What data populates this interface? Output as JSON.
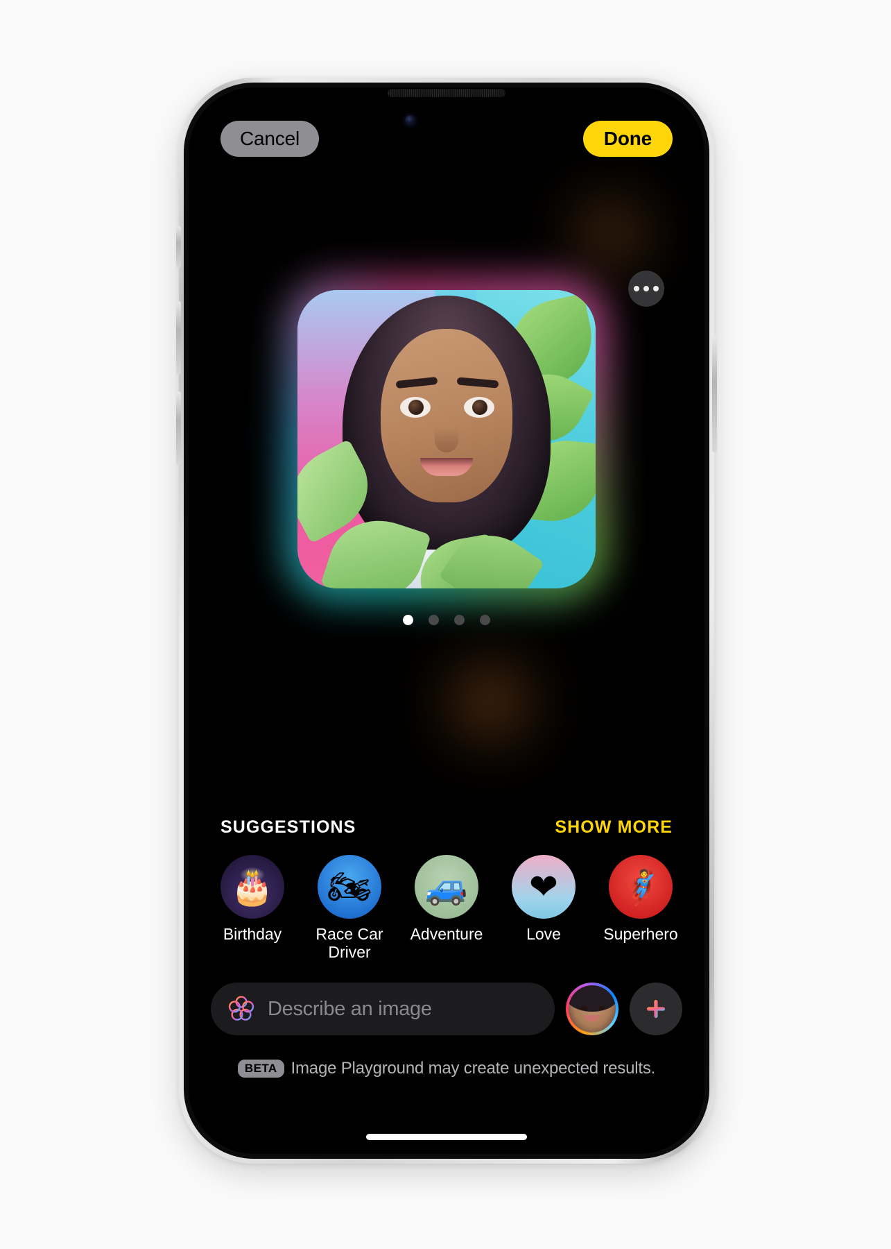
{
  "app": {
    "name": "Image Playground",
    "background_color": "#000000",
    "accent_color": "#FFD60A"
  },
  "topbar": {
    "cancel_label": "Cancel",
    "done_label": "Done"
  },
  "preview": {
    "more_icon": "ellipsis-icon",
    "image_description": "Illustrated portrait of a smiling young woman with long curly dark hair surrounded by green tropical leaves on a pink and teal background",
    "pager": {
      "count": 4,
      "active_index": 0
    }
  },
  "suggestions": {
    "title": "SUGGESTIONS",
    "show_more_label": "SHOW MORE",
    "items": [
      {
        "label": "Birthday",
        "icon": "birthday-cake-icon",
        "glyph": "🎂",
        "bg": "#2e1f4d"
      },
      {
        "label": "Race Car Driver",
        "icon": "racing-helmet-icon",
        "glyph": "🏍",
        "bg": "#2e8fe0"
      },
      {
        "label": "Adventure",
        "icon": "off-road-truck-icon",
        "glyph": "🚙",
        "bg": "#a8c6a4"
      },
      {
        "label": "Love",
        "icon": "heart-balloon-icon",
        "glyph": "❤",
        "bg": "#7fc7e8"
      },
      {
        "label": "Superhero",
        "icon": "superhero-mask-icon",
        "glyph": "🦸",
        "bg": "#e03030"
      }
    ]
  },
  "composer": {
    "ai_icon": "apple-intelligence-icon",
    "input_placeholder": "Describe an image",
    "input_value": "",
    "avatar_icon": "person-avatar-icon",
    "add_icon": "plus-icon"
  },
  "footer": {
    "badge": "BETA",
    "text": "Image Playground may create unexpected results."
  }
}
